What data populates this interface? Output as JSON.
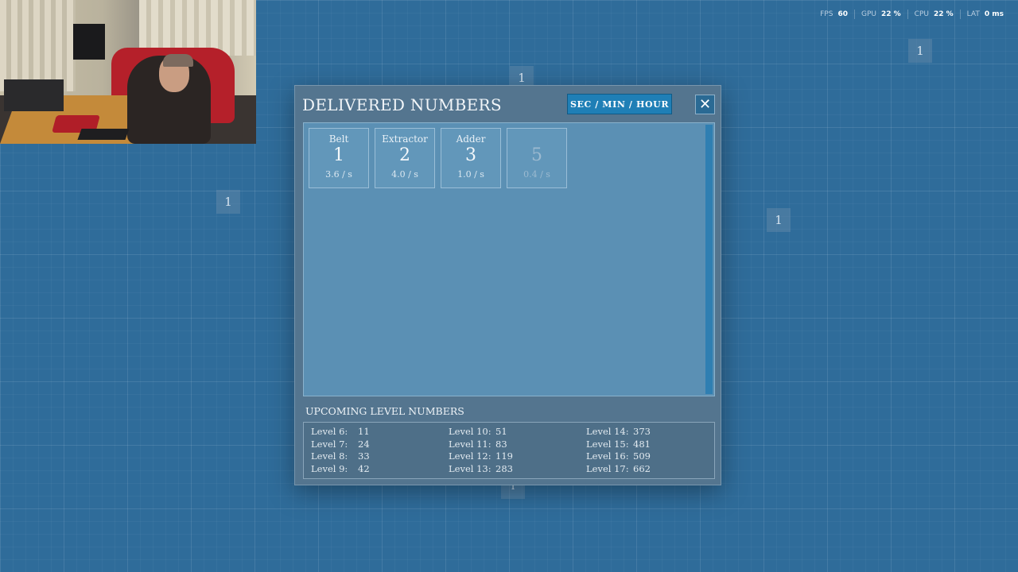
{
  "hud": {
    "fps_label": "FPS",
    "fps_value": "60",
    "gpu_label": "GPU",
    "gpu_value": "22 %",
    "cpu_label": "CPU",
    "cpu_value": "22 %",
    "lat_label": "LAT",
    "lat_value": "0 ms"
  },
  "map_tiles": [
    "1",
    "1",
    "1",
    "1",
    "1"
  ],
  "dialog": {
    "title": "DELIVERED NUMBERS",
    "unit_toggle": "SEC / MIN / HOUR",
    "close": "✕",
    "cards": [
      {
        "name": "Belt",
        "number": "1",
        "rate": "3.6 / s",
        "dim": false
      },
      {
        "name": "Extractor",
        "number": "2",
        "rate": "4.0 / s",
        "dim": false
      },
      {
        "name": "Adder",
        "number": "3",
        "rate": "1.0 / s",
        "dim": false
      },
      {
        "name": "",
        "number": "5",
        "rate": "0.4 / s",
        "dim": true
      }
    ],
    "upcoming_title": "UPCOMING LEVEL NUMBERS",
    "levels": [
      {
        "label": "Level 6:",
        "value": "11"
      },
      {
        "label": "Level 7:",
        "value": "24"
      },
      {
        "label": "Level 8:",
        "value": "33"
      },
      {
        "label": "Level 9:",
        "value": "42"
      },
      {
        "label": "Level 10:",
        "value": "51"
      },
      {
        "label": "Level 11:",
        "value": "83"
      },
      {
        "label": "Level 12:",
        "value": "119"
      },
      {
        "label": "Level 13:",
        "value": "283"
      },
      {
        "label": "Level 14:",
        "value": "373"
      },
      {
        "label": "Level 15:",
        "value": "481"
      },
      {
        "label": "Level 16:",
        "value": "509"
      },
      {
        "label": "Level 17:",
        "value": "662"
      }
    ]
  }
}
